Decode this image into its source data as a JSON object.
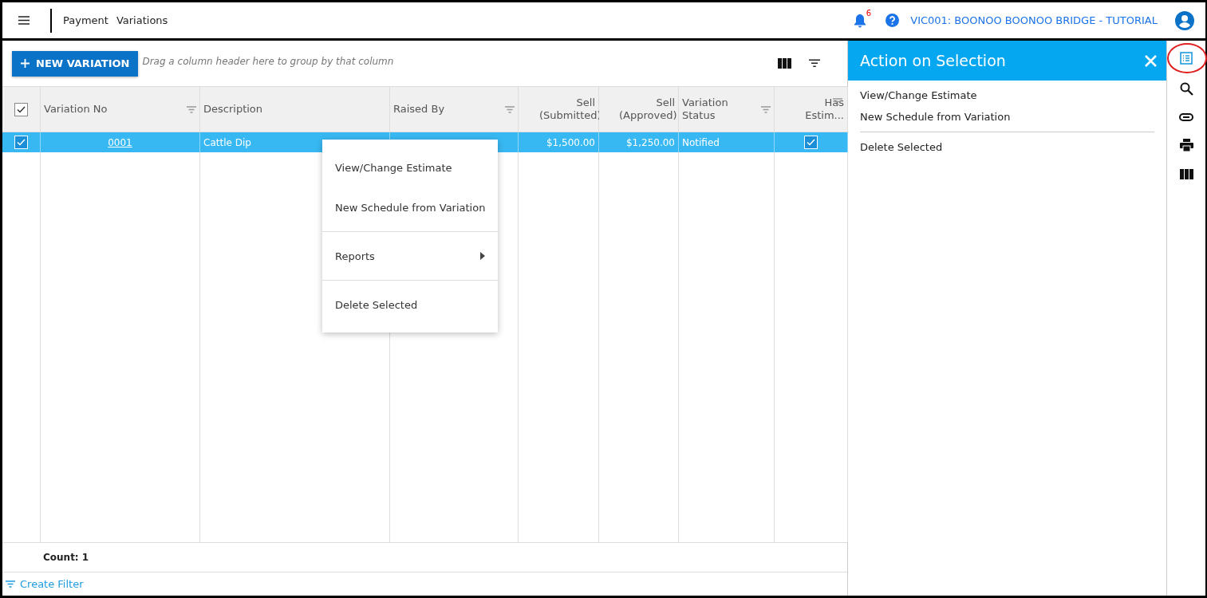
{
  "header": {
    "breadcrumb": [
      "Payment",
      "Variations"
    ],
    "notifications": {
      "count": "6"
    },
    "project": "VIC001: BOONOO BOONOO BRIDGE - TUTORIAL"
  },
  "toolbar": {
    "new_button": "NEW VARIATION",
    "group_hint": "Drag a column header here to group by that column"
  },
  "table": {
    "all_checked": true,
    "columns": [
      {
        "label": "Variation No",
        "filter": true
      },
      {
        "label": "Description",
        "filter": false
      },
      {
        "label": "Raised By",
        "filter": true
      },
      {
        "label": "Sell (Submitted)",
        "filter": false
      },
      {
        "label": "Sell (Approved)",
        "filter": false
      },
      {
        "label": "Variation Status",
        "filter": true
      },
      {
        "label": "Has Estim...",
        "filter": true
      }
    ],
    "rows": [
      {
        "selected": true,
        "checked": true,
        "variation_no": "0001",
        "description": "Cattle Dip",
        "sell_submitted": "$1,500.00",
        "sell_approved": "$1,250.00",
        "status": "Notified",
        "has_estimate": true
      }
    ],
    "count": "Count: 1",
    "create_filter": "Create Filter"
  },
  "context_menu": {
    "items": [
      {
        "kind": "item",
        "label": "View/Change Estimate"
      },
      {
        "kind": "item",
        "label": "New Schedule from Variation"
      },
      {
        "kind": "divider"
      },
      {
        "kind": "submenu",
        "label": "Reports"
      },
      {
        "kind": "divider"
      },
      {
        "kind": "item",
        "label": "Delete Selected"
      }
    ]
  },
  "panel": {
    "title": "Action on Selection",
    "items": [
      {
        "kind": "item",
        "label": "View/Change Estimate"
      },
      {
        "kind": "item",
        "label": "New Schedule from Variation"
      },
      {
        "kind": "divider"
      },
      {
        "kind": "item",
        "label": "Delete Selected"
      }
    ]
  },
  "rail": [
    {
      "selected": true
    },
    {
      "selected": false
    },
    {
      "selected": false
    },
    {
      "selected": false
    },
    {
      "selected": false
    }
  ]
}
